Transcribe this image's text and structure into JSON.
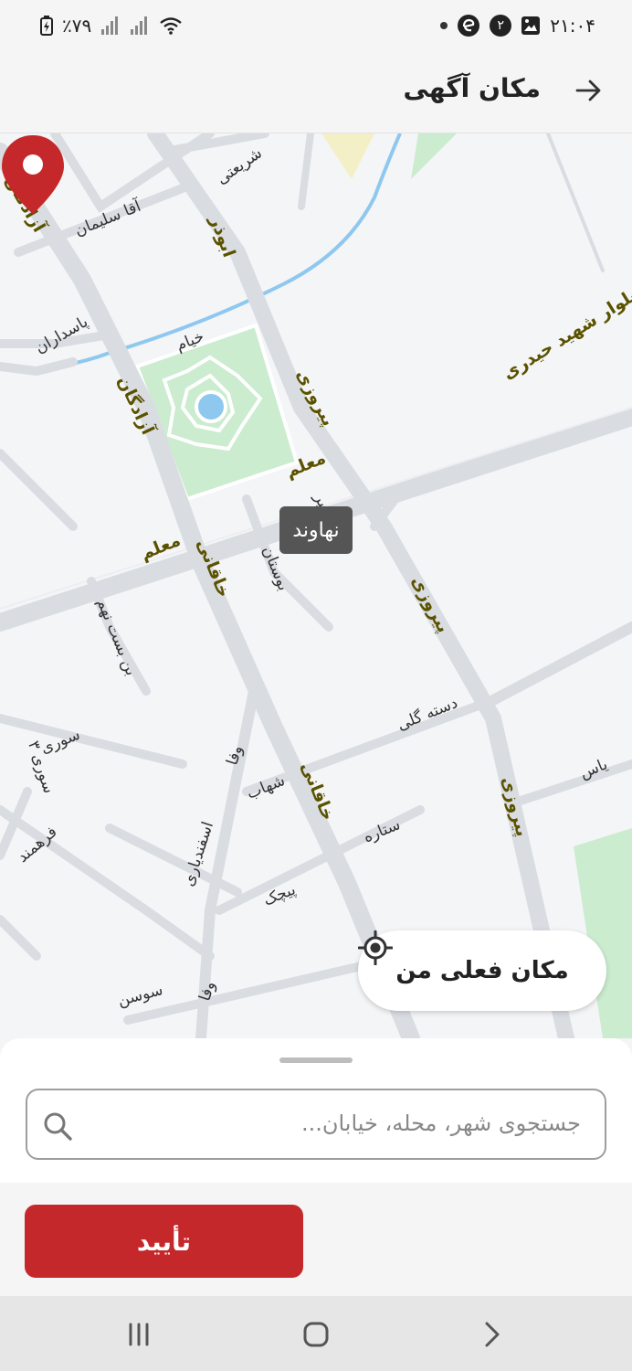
{
  "status_bar": {
    "time": "۲۱:۰۴",
    "notification_count": "۲",
    "battery": "٪۷۹"
  },
  "app_bar": {
    "title": "مکان آگهی"
  },
  "map": {
    "streets": {
      "sharieti": "شریعتی",
      "aqa_soleiman": "آقا سلیمان",
      "azadegan_top": "آزادگان",
      "abuzar": "ابوذر",
      "pasdaran": "پاسداران",
      "khayyam": "خیام",
      "azadegan": "آزادگان",
      "piruzi_1": "پیروزی",
      "moalem_1": "معلم",
      "shahid_heidari": "بلوار شهید حیدری",
      "moalem_2": "معلم",
      "khaqani_1": "خاقانی",
      "bustan": "بوستان",
      "amir": "امیر",
      "piruzi_2": "پیروزی",
      "bonbast_nohom": "بن بست نهم",
      "dasteh_goli": "دسته گلی",
      "suri": "سوری",
      "suri_3": "سوری ۳",
      "vafa_1": "وفا",
      "shahab": "شهاب",
      "khaqani_2": "خاقانی",
      "yas": "یاس",
      "piruzi_3": "پیروزی",
      "farahmand": "فرهمند",
      "esfandiari": "اسفندیاری",
      "setareh": "ستاره",
      "pichak": "پیچک",
      "vafa_2": "وفا",
      "susan": "سوسن"
    },
    "pin_tooltip": "نهاوند",
    "current_location_button": "مکان فعلی من"
  },
  "search": {
    "placeholder": "جستجوی شهر، محله، خیابان..."
  },
  "confirm_button": "تأیید",
  "colors": {
    "accent": "#c4282b",
    "park": "#cbeccf",
    "water": "#8ec8ef",
    "road": "#d9dde2"
  }
}
